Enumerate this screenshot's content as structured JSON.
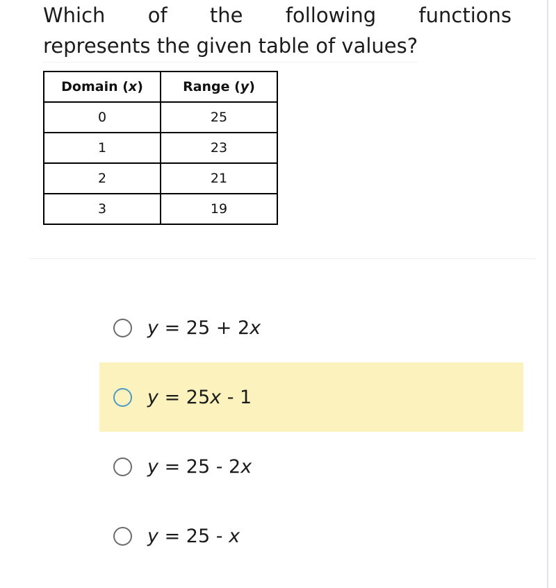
{
  "question": {
    "line1_words": [
      "Which",
      "of",
      "the",
      "following",
      "functions"
    ],
    "line2": "represents the given table of values?",
    "full_text": "Which of the following functions represents the given table of values?"
  },
  "table": {
    "headers": [
      {
        "text": "Domain",
        "variable": "x"
      },
      {
        "text": "Range",
        "variable": "y"
      }
    ],
    "rows": [
      {
        "domain": "0",
        "range": "25"
      },
      {
        "domain": "1",
        "range": "23"
      },
      {
        "domain": "2",
        "range": "21"
      },
      {
        "domain": "3",
        "range": "19"
      }
    ]
  },
  "options": [
    {
      "id": "option-a",
      "prefix": "y",
      "equals": "=",
      "expression": "25 + 2",
      "suffix_var": "x",
      "full_text": "y = 25 + 2x",
      "selected": false,
      "highlighted": false
    },
    {
      "id": "option-b",
      "prefix": "y",
      "equals": "=",
      "expression": "25",
      "suffix_var": "x",
      "tail": " - 1",
      "full_text": "y = 25x - 1",
      "selected": false,
      "highlighted": true
    },
    {
      "id": "option-c",
      "prefix": "y",
      "equals": "=",
      "expression": "25 - 2",
      "suffix_var": "x",
      "full_text": "y = 25 - 2x",
      "selected": false,
      "highlighted": false
    },
    {
      "id": "option-d",
      "prefix": "y",
      "equals": "=",
      "expression": "25 - ",
      "suffix_var": "x",
      "full_text": "y = 25 - x",
      "selected": false,
      "highlighted": false
    }
  ],
  "colors": {
    "page_background": "#ffffff",
    "text": "#1b1b1b",
    "table_border": "#000000",
    "separator": "#eeeef0",
    "highlight_background": "#fcf2bd",
    "radio_unselected_border": "#6b6b6b",
    "radio_highlighted_border": "#4c9ac4",
    "right_edge_rule": "#e4e1f7"
  }
}
